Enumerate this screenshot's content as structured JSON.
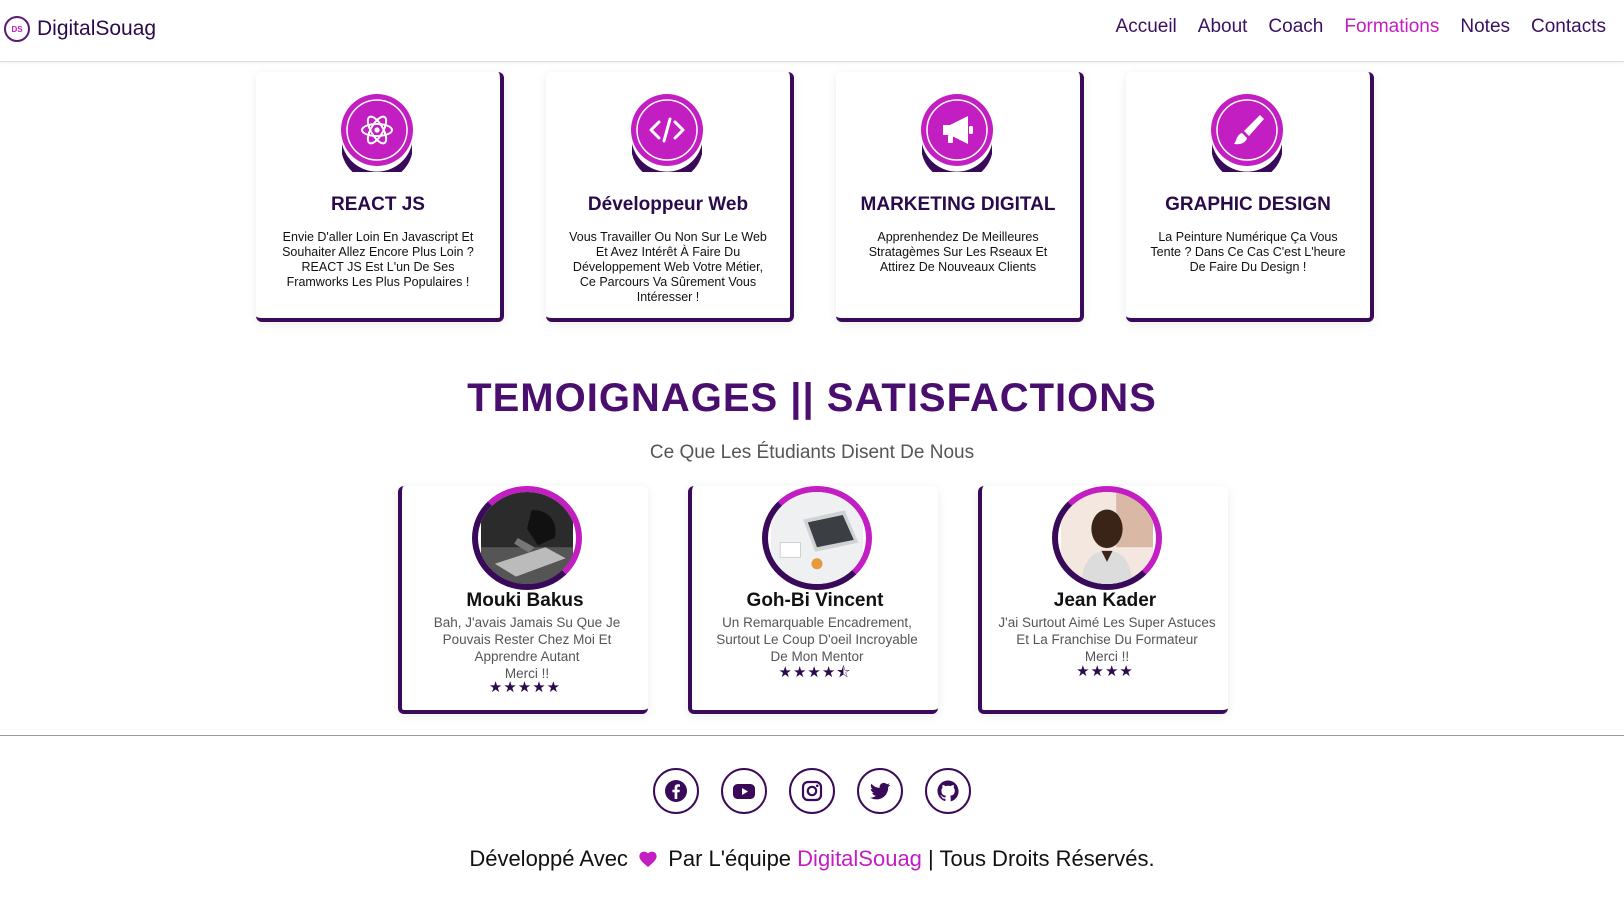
{
  "brand": {
    "logo_text": "DS",
    "name": "DigitalSouag"
  },
  "nav": {
    "items": [
      {
        "label": "Accueil",
        "active": false
      },
      {
        "label": "About",
        "active": false
      },
      {
        "label": "Coach",
        "active": false
      },
      {
        "label": "Formations",
        "active": true
      },
      {
        "label": "Notes",
        "active": false
      },
      {
        "label": "Contacts",
        "active": false
      }
    ]
  },
  "courses": [
    {
      "icon": "react-icon",
      "title": "REACT JS",
      "description": "Envie D'aller Loin En Javascript Et Souhaiter Allez Encore Plus Loin ? REACT JS Est L'un De Ses Framworks Les Plus Populaires !"
    },
    {
      "icon": "code-icon",
      "title": "Développeur Web",
      "description": "Vous Travailler Ou Non Sur Le Web Et Avez Intérêt À Faire Du Développement Web Votre Métier, Ce Parcours Va Sûrement Vous Intéresser !"
    },
    {
      "icon": "megaphone-icon",
      "title": "MARKETING DIGITAL",
      "description": "Apprenhendez De Meilleures Stratagèmes Sur Les Rseaux Et Attirez De Nouveaux Clients"
    },
    {
      "icon": "paintbrush-icon",
      "title": "GRAPHIC DESIGN",
      "description": "La Peinture Numérique Ça Vous Tente ? Dans Ce Cas C'est L'heure De Faire Du Design !"
    }
  ],
  "testimonials_section": {
    "title": "TEMOIGNAGES || SATISFACTIONS",
    "subtitle": "Ce Que Les Étudiants Disent De Nous"
  },
  "testimonials": [
    {
      "name": "Mouki Bakus",
      "text": "Bah, J'avais Jamais Su Que Je Pouvais Rester Chez Moi Et Apprendre Autant",
      "merci": "Merci !!",
      "rating": 5,
      "stars": "★★★★★"
    },
    {
      "name": "Goh-Bi Vincent",
      "text": "Un Remarquable Encadrement, Surtout Le Coup D'oeil Incroyable De Mon Mentor",
      "merci": "",
      "rating": 4.5,
      "stars": "★★★★⯪"
    },
    {
      "name": "Jean Kader",
      "text": "J'ai Surtout Aimé Les Super Astuces Et La Franchise Du Formateur",
      "merci": "Merci !!",
      "rating": 4,
      "stars": "★★★★"
    }
  ],
  "footer": {
    "socials": [
      "facebook-icon",
      "youtube-icon",
      "instagram-icon",
      "twitter-icon",
      "github-icon"
    ],
    "text_before": "Développé Avec",
    "text_middle": "Par L'équipe",
    "brand": "DigitalSouag",
    "text_after": "| Tous Droits Réservés."
  },
  "colors": {
    "accent": "#c21ec2",
    "dark": "#3a0a5a",
    "title": "#4a0f6e"
  }
}
